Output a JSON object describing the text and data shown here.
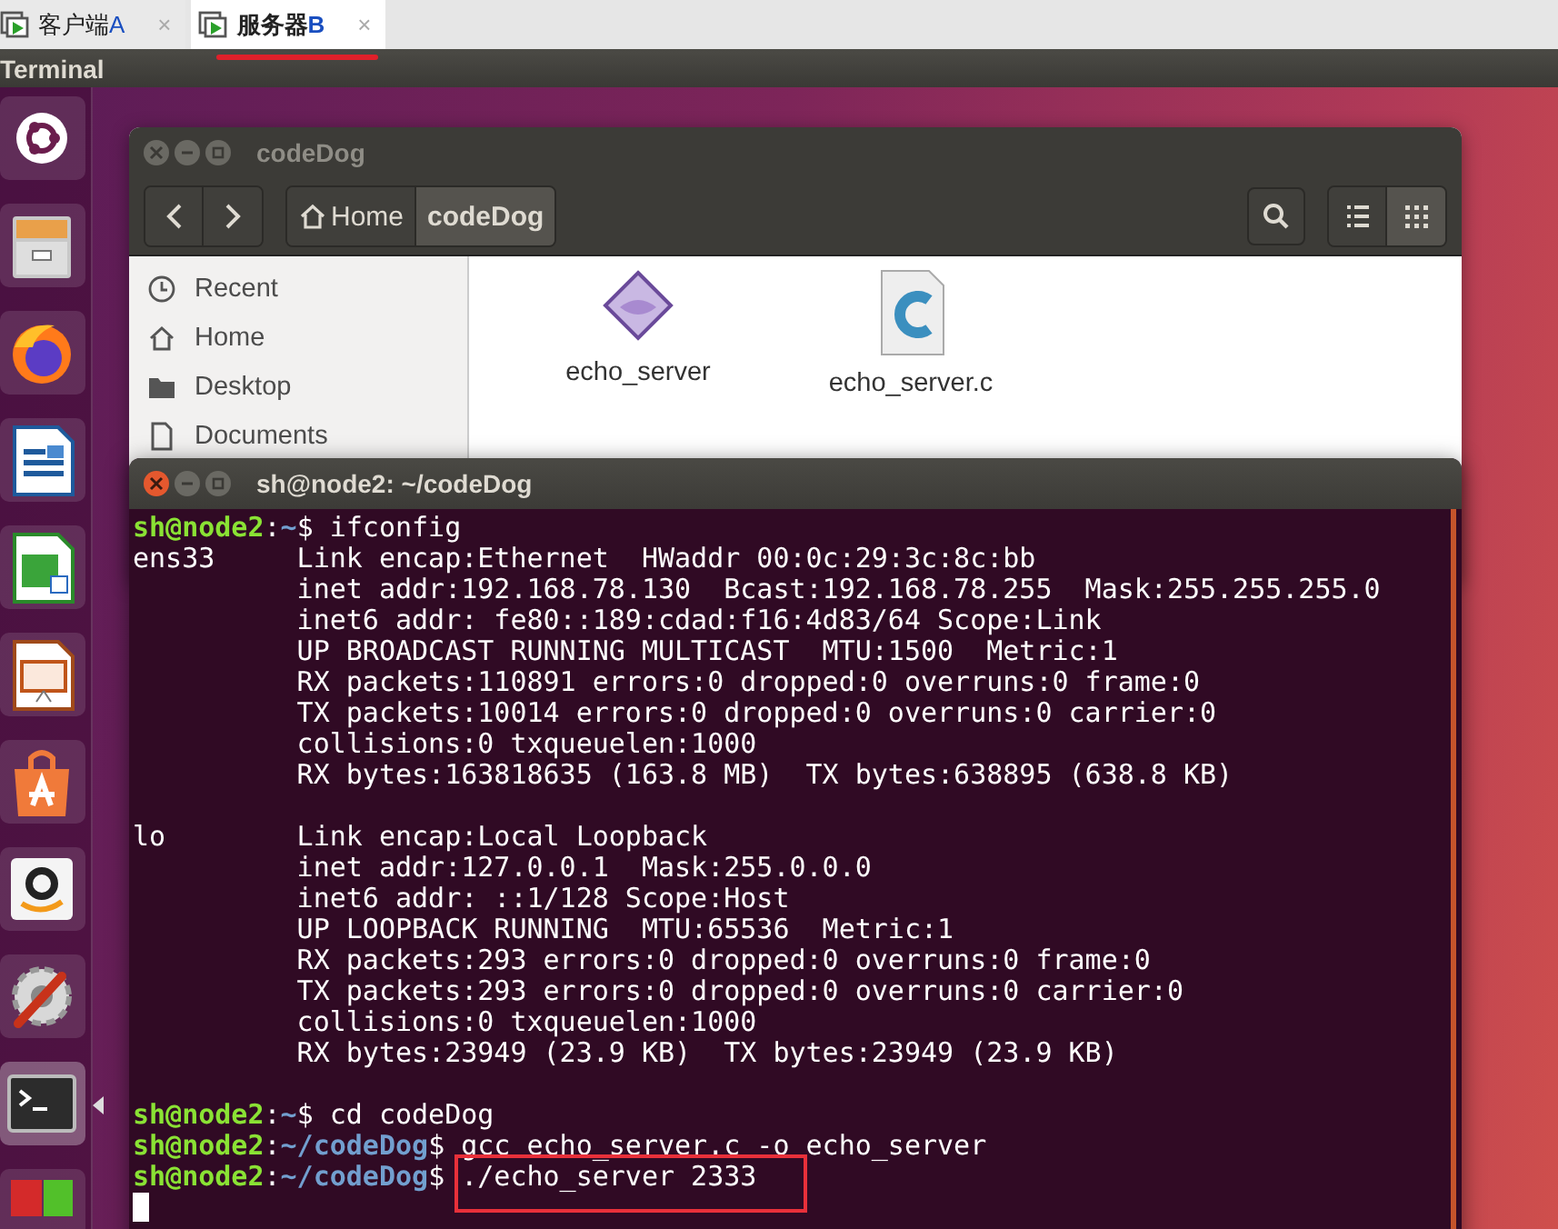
{
  "tabs": [
    {
      "label": "客户端",
      "suffix": "A",
      "close": "×",
      "selected": false,
      "underlined": false
    },
    {
      "label": "服务器",
      "suffix": "B",
      "close": "×",
      "selected": true,
      "underlined": true
    }
  ],
  "panel": {
    "title": "Terminal"
  },
  "launcher": [
    {
      "kind": "dash",
      "active": false
    },
    {
      "kind": "files",
      "active": false
    },
    {
      "kind": "browser",
      "active": false
    },
    {
      "kind": "writer",
      "active": false
    },
    {
      "kind": "calc",
      "active": false
    },
    {
      "kind": "impress",
      "active": false
    },
    {
      "kind": "store",
      "active": false
    },
    {
      "kind": "shop",
      "active": false
    },
    {
      "kind": "settings",
      "active": false
    },
    {
      "kind": "terminal",
      "active": true
    },
    {
      "kind": "squares",
      "active": false
    }
  ],
  "files_window": {
    "title": "codeDog",
    "breadcrumb": [
      {
        "label": "Home",
        "kind": "home",
        "selected": false
      },
      {
        "label": "codeDog",
        "kind": "folder",
        "selected": true
      }
    ],
    "view_buttons": [
      {
        "kind": "list",
        "selected": false
      },
      {
        "kind": "grid",
        "selected": true
      }
    ],
    "sidebar": [
      {
        "label": "Recent",
        "kind": "recent"
      },
      {
        "label": "Home",
        "kind": "home"
      },
      {
        "label": "Desktop",
        "kind": "folder"
      },
      {
        "label": "Documents",
        "kind": "document"
      }
    ],
    "files": [
      {
        "name": "echo_server",
        "kind": "executable"
      },
      {
        "name": "echo_server.c",
        "kind": "c-source"
      }
    ]
  },
  "terminal": {
    "title": "sh@node2: ~/codeDog",
    "lines": [
      {
        "kind": "prompt",
        "user": "sh@node2",
        "sep": ":",
        "path": "~",
        "end": "$ ",
        "command": "ifconfig",
        "highlighted": false
      },
      {
        "kind": "output",
        "text": "ens33     Link encap:Ethernet  HWaddr 00:0c:29:3c:8c:bb"
      },
      {
        "kind": "output",
        "text": "          inet addr:192.168.78.130  Bcast:192.168.78.255  Mask:255.255.255.0"
      },
      {
        "kind": "output",
        "text": "          inet6 addr: fe80::189:cdad:f16:4d83/64 Scope:Link"
      },
      {
        "kind": "output",
        "text": "          UP BROADCAST RUNNING MULTICAST  MTU:1500  Metric:1"
      },
      {
        "kind": "output",
        "text": "          RX packets:110891 errors:0 dropped:0 overruns:0 frame:0"
      },
      {
        "kind": "output",
        "text": "          TX packets:10014 errors:0 dropped:0 overruns:0 carrier:0"
      },
      {
        "kind": "output",
        "text": "          collisions:0 txqueuelen:1000"
      },
      {
        "kind": "output",
        "text": "          RX bytes:163818635 (163.8 MB)  TX bytes:638895 (638.8 KB)"
      },
      {
        "kind": "blank"
      },
      {
        "kind": "output",
        "text": "lo        Link encap:Local Loopback"
      },
      {
        "kind": "output",
        "text": "          inet addr:127.0.0.1  Mask:255.0.0.0"
      },
      {
        "kind": "output",
        "text": "          inet6 addr: ::1/128 Scope:Host"
      },
      {
        "kind": "output",
        "text": "          UP LOOPBACK RUNNING  MTU:65536  Metric:1"
      },
      {
        "kind": "output",
        "text": "          RX packets:293 errors:0 dropped:0 overruns:0 frame:0"
      },
      {
        "kind": "output",
        "text": "          TX packets:293 errors:0 dropped:0 overruns:0 carrier:0"
      },
      {
        "kind": "output",
        "text": "          collisions:0 txqueuelen:1000"
      },
      {
        "kind": "output",
        "text": "          RX bytes:23949 (23.9 KB)  TX bytes:23949 (23.9 KB)"
      },
      {
        "kind": "blank"
      },
      {
        "kind": "prompt",
        "user": "sh@node2",
        "sep": ":",
        "path": "~",
        "end": "$ ",
        "command": "cd codeDog",
        "highlighted": false
      },
      {
        "kind": "prompt",
        "user": "sh@node2",
        "sep": ":",
        "path": "~/codeDog",
        "end": "$ ",
        "command": "gcc echo_server.c -o echo_server",
        "highlighted": false
      },
      {
        "kind": "prompt",
        "user": "sh@node2",
        "sep": ":",
        "path": "~/codeDog",
        "end": "$ ",
        "command": "./echo_server 2333",
        "highlighted": true
      },
      {
        "kind": "cursor"
      }
    ]
  }
}
